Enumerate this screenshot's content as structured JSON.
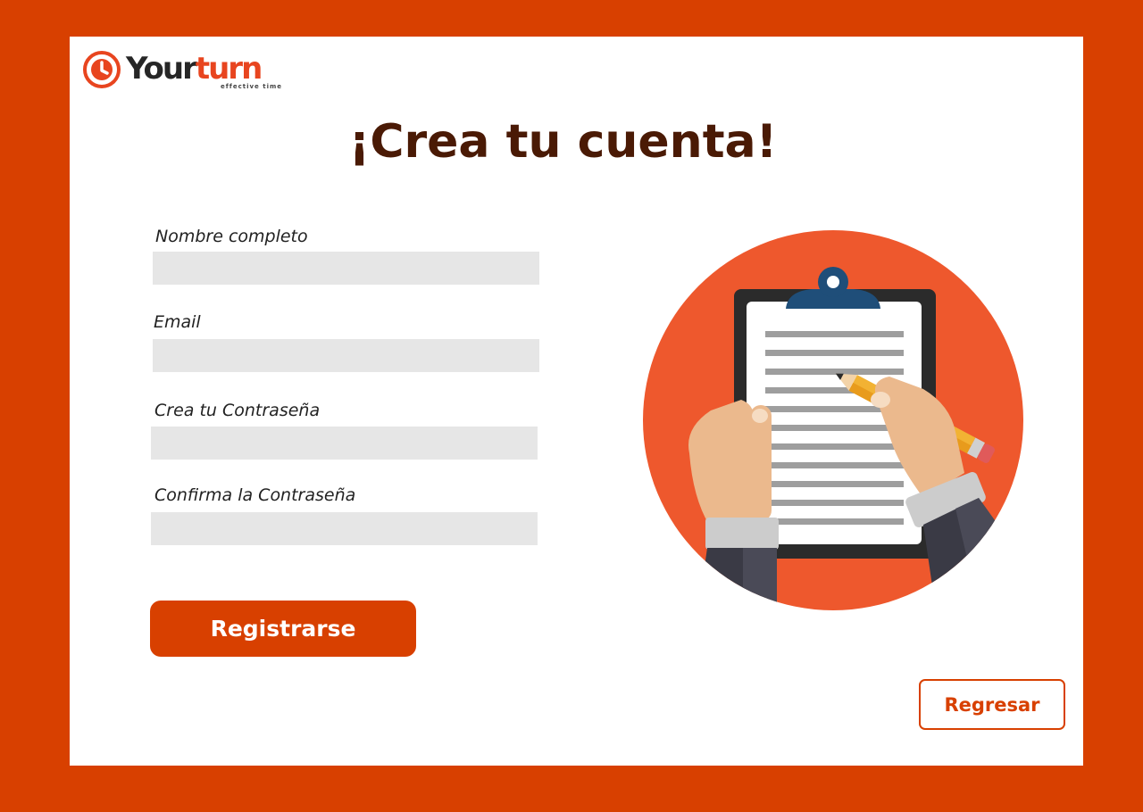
{
  "brand": {
    "word_your": "Your",
    "word_turn": "turn",
    "tagline": "effective time",
    "color_primary": "#d84000",
    "color_logo": "#e8451f"
  },
  "page": {
    "title": "¡Crea tu cuenta!"
  },
  "form": {
    "fields": [
      {
        "label": "Nombre completo",
        "value": "",
        "placeholder": ""
      },
      {
        "label": "Email",
        "value": "",
        "placeholder": ""
      },
      {
        "label": "Crea tu Contraseña",
        "value": "",
        "placeholder": ""
      },
      {
        "label": "Confirma la  Contraseña",
        "value": "",
        "placeholder": ""
      }
    ],
    "submit_label": "Registrarse"
  },
  "nav": {
    "back_label": "Regresar"
  },
  "illustration": {
    "icon": "clipboard-writing-illustration",
    "circle_color": "#ee582d"
  }
}
